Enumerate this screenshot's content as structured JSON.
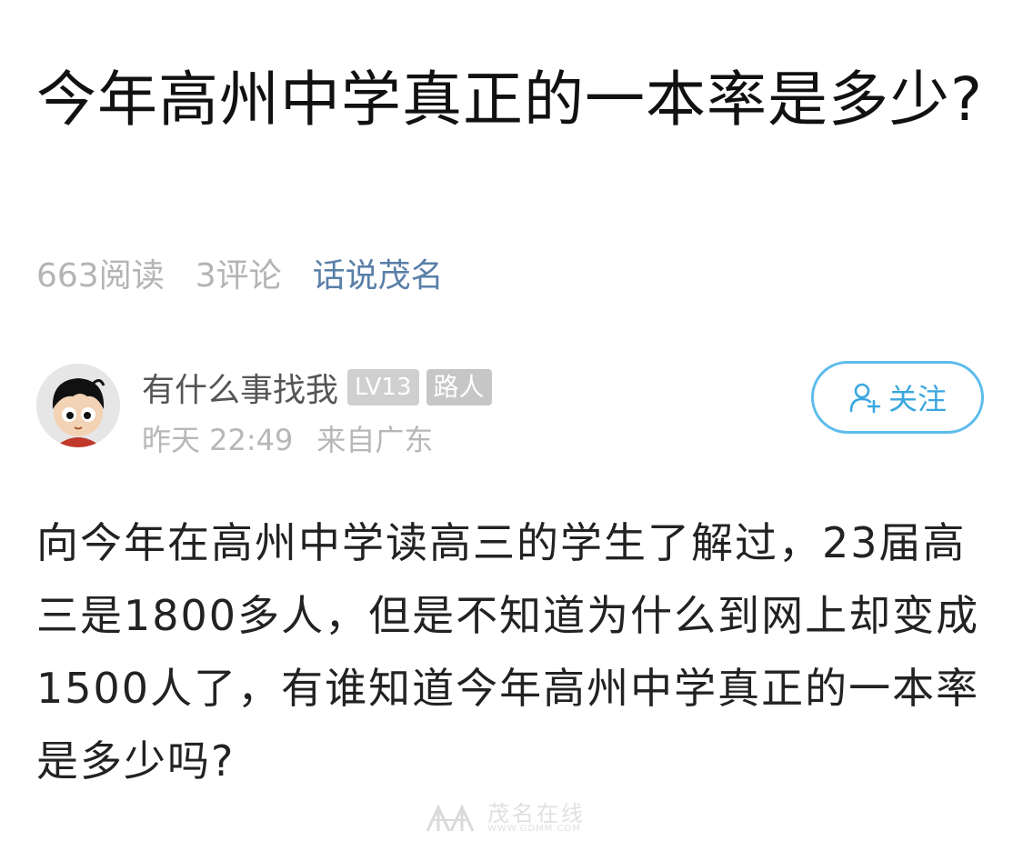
{
  "post": {
    "title": "今年高州中学真正的一本率是多少?",
    "meta": {
      "reads": "663阅读",
      "comments": "3评论",
      "topic": "话说茂名"
    },
    "author": {
      "name": "有什么事找我",
      "level": "LV13",
      "role": "路人",
      "time": "昨天 22:49",
      "location": "来自广东"
    },
    "follow_label": "关注",
    "body": "向今年在高州中学读高三的学生了解过，23届高三是1800多人，但是不知道为什么到网上却变成1500人了，有谁知道今年高州中学真正的一本率是多少吗?"
  },
  "watermark": {
    "text_cn": "茂名在线",
    "url": "WWW.GDMM.COM"
  },
  "colors": {
    "topic": "#5a7fa8",
    "follow_accent": "#5cbcec",
    "meta_gray": "#b4b4b4",
    "badge_gray": "#cfcfcf"
  },
  "icons": {
    "follow": "add-user-icon",
    "avatar": "cartoon-face-avatar"
  }
}
